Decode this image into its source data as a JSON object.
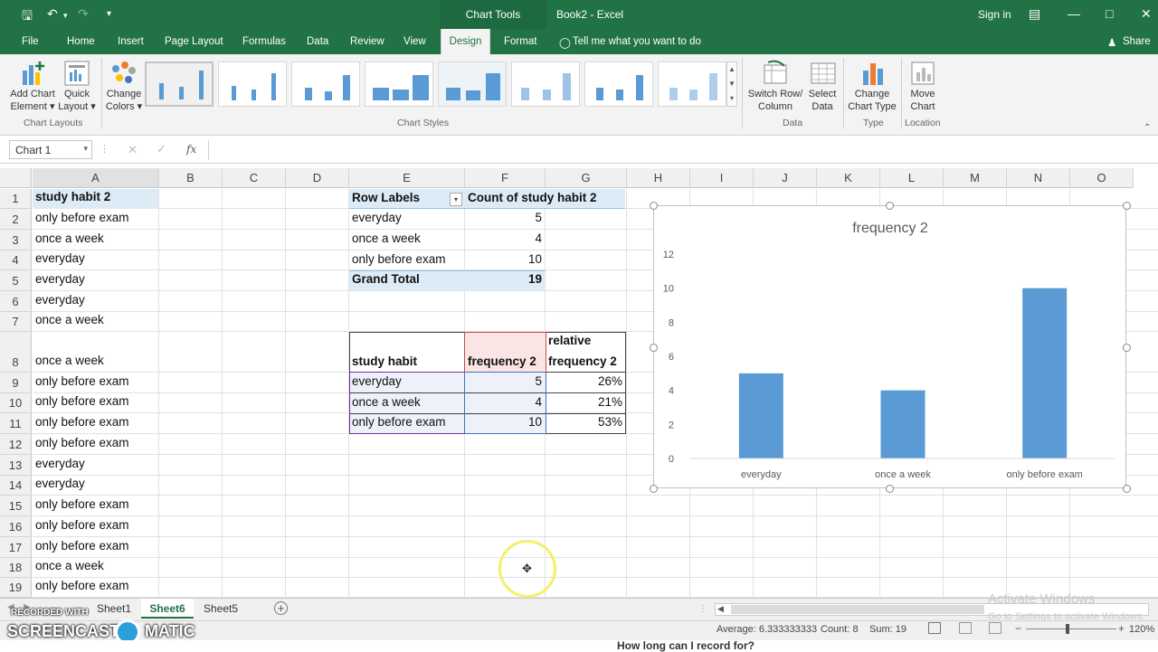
{
  "titlebar": {
    "chart_tools": "Chart Tools",
    "title": "Book2 - Excel",
    "signin": "Sign in",
    "share": "Share"
  },
  "menu": [
    "File",
    "Home",
    "Insert",
    "Page Layout",
    "Formulas",
    "Data",
    "Review",
    "View",
    "Design",
    "Format"
  ],
  "tell_me": "Tell me what you want to do",
  "ribbon": {
    "add_chart_element": [
      "Add Chart",
      "Element"
    ],
    "quick_layout": [
      "Quick",
      "Layout"
    ],
    "change_colors": [
      "Change",
      "Colors"
    ],
    "switch_row_col": [
      "Switch Row/",
      "Column"
    ],
    "select_data": [
      "Select",
      "Data"
    ],
    "change_chart_type": [
      "Change",
      "Chart Type"
    ],
    "move_chart": [
      "Move",
      "Chart"
    ],
    "groups": {
      "chart_layouts": "Chart Layouts",
      "chart_styles": "Chart Styles",
      "data": "Data",
      "type": "Type",
      "location": "Location"
    }
  },
  "namebox": "Chart 1",
  "fx": "fx",
  "columns": [
    "A",
    "B",
    "C",
    "D",
    "E",
    "F",
    "G",
    "H",
    "I",
    "J",
    "K",
    "L",
    "M",
    "N",
    "O"
  ],
  "rows": [
    "1",
    "2",
    "3",
    "4",
    "5",
    "6",
    "7",
    "8",
    "9",
    "10",
    "11",
    "12",
    "13",
    "14",
    "15",
    "16",
    "17",
    "18",
    "19"
  ],
  "col_a": [
    "study habit 2",
    "only before exam",
    "once a week",
    "everyday",
    "everyday",
    "everyday",
    "once a week",
    "once a week",
    "only before exam",
    "only before exam",
    "only before exam",
    "only before exam",
    "everyday",
    "everyday",
    "only before exam",
    "only before exam",
    "only before exam",
    "once a week",
    "only before exam"
  ],
  "pivot": {
    "header_label": "Row Labels",
    "header_count": "Count of study habit 2",
    "rows": [
      {
        "label": "everyday",
        "count": "5"
      },
      {
        "label": "once a week",
        "count": "4"
      },
      {
        "label": "only before exam",
        "count": "10"
      }
    ],
    "total_label": "Grand Total",
    "total_value": "19"
  },
  "freq_table": {
    "h1": "study habit",
    "h2": "frequency 2",
    "h3a": "relative",
    "h3b": "frequency 2",
    "rows": [
      {
        "habit": "everyday",
        "freq": "5",
        "rel": "26%"
      },
      {
        "habit": "once a week",
        "freq": "4",
        "rel": "21%"
      },
      {
        "habit": "only before exam",
        "freq": "10",
        "rel": "53%"
      }
    ]
  },
  "chart_data": {
    "type": "bar",
    "title": "frequency 2",
    "categories": [
      "everyday",
      "once a week",
      "only before exam"
    ],
    "values": [
      5,
      4,
      10
    ],
    "ylim": [
      0,
      12
    ],
    "yticks": [
      "0",
      "2",
      "4",
      "6",
      "8",
      "10",
      "12"
    ],
    "color": "#5b9bd5",
    "grid": false
  },
  "sheets": [
    "Sheet1",
    "Sheet6",
    "Sheet5"
  ],
  "active_sheet": "Sheet6",
  "status": {
    "average": "Average: 6.333333333",
    "count": "Count: 8",
    "sum": "Sum: 19",
    "zoom": "120%"
  },
  "watermark": {
    "recorded": "RECORDED WITH",
    "brand": "SCREENCAST",
    "brand2": "MATIC",
    "activate": "Activate Windows",
    "activate_sub": "Go to Settings to activate Windows.",
    "banner": "How long can I record for?"
  }
}
